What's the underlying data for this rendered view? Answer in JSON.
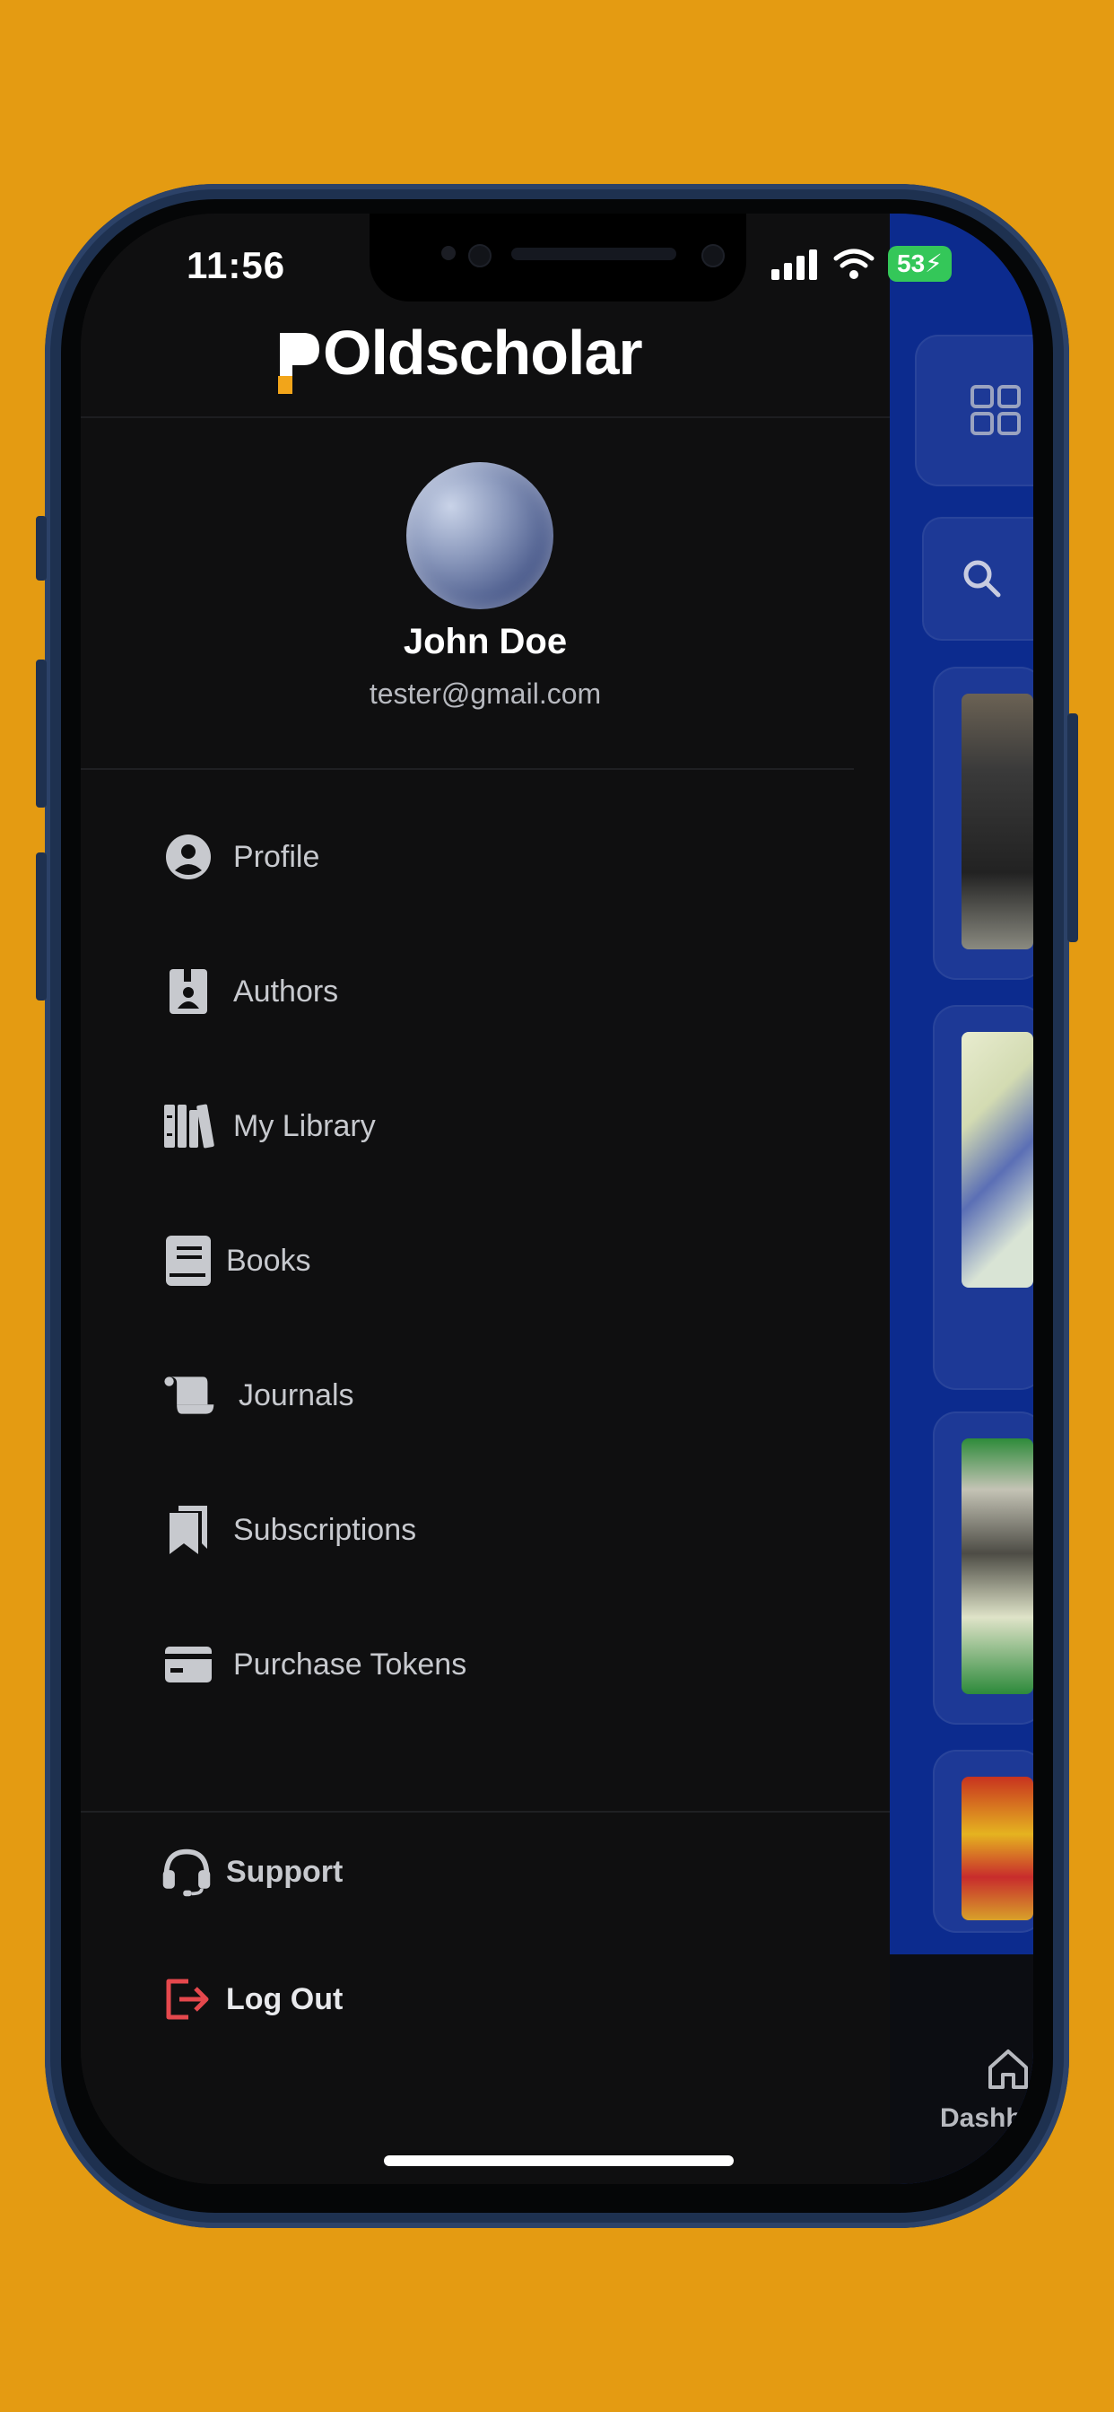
{
  "status_bar": {
    "time": "11:56",
    "battery": "53"
  },
  "app": {
    "logo_text": "Oldscholar",
    "logo_letter": "P"
  },
  "user": {
    "name": "John Doe",
    "email": "tester@gmail.com"
  },
  "menu": {
    "items": [
      {
        "label": "Profile",
        "icon": "account-circle-icon"
      },
      {
        "label": "Authors",
        "icon": "contact-book-icon"
      },
      {
        "label": "My Library",
        "icon": "library-books-icon"
      },
      {
        "label": "Books",
        "icon": "book-icon"
      },
      {
        "label": "Journals",
        "icon": "scroll-icon"
      },
      {
        "label": "Subscriptions",
        "icon": "bookmarks-icon"
      },
      {
        "label": "Purchase Tokens",
        "icon": "credit-card-icon"
      }
    ],
    "footer": [
      {
        "label": "Support",
        "icon": "headset-icon"
      },
      {
        "label": "Log Out",
        "icon": "logout-icon",
        "color": "#e5484d"
      }
    ]
  },
  "background_app": {
    "bottom_tab_label": "Dashb",
    "accent": "#0c2b8e"
  },
  "colors": {
    "page_background": "#e49b12",
    "drawer_background": "#0f0f10",
    "menu_text": "#c7c9ce",
    "logout": "#e5484d"
  }
}
